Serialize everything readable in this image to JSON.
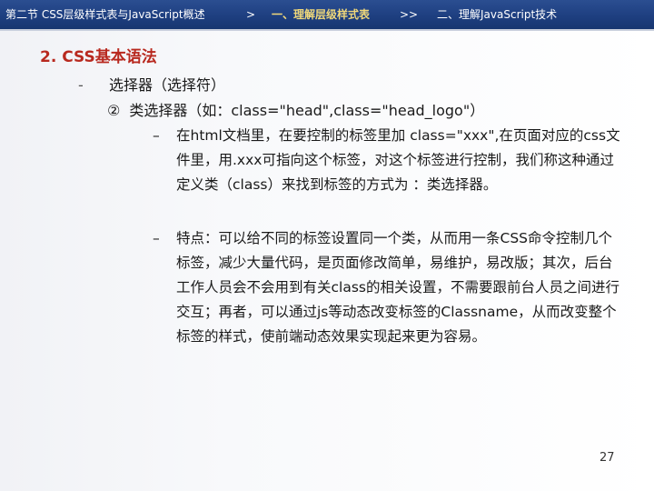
{
  "header": {
    "crumb1": "第二节 CSS层级样式表与JavaScript概述",
    "sep1": ">",
    "crumb2": "一、理解层级样式表",
    "sep2": ">>",
    "crumb3": "二、理解JavaScript技术"
  },
  "slide": {
    "heading": "2. CSS基本语法",
    "level1": {
      "marker": "-",
      "text": "选择器（选择符）"
    },
    "level2": {
      "marker": "②",
      "text": "类选择器（如：class=\"head\",class=\"head_logo\"）"
    },
    "bullets": [
      {
        "marker": "–",
        "text": "在html文档里，在要控制的标签里加 class=\"xxx\",在页面对应的css文件里，用.xxx可指向这个标签，对这个标签进行控制，我们称这种通过定义类（class）来找到标签的方式为 ：类选择器。"
      },
      {
        "marker": "–",
        "text": "特点：可以给不同的标签设置同一个类，从而用一条CSS命令控制几个标签，减少大量代码，是页面修改简单，易维护，易改版；其次，后台工作人员会不会用到有关class的相关设置，不需要跟前台人员之间进行交互；再者，可以通过js等动态改变标签的Classname，从而改变整个标签的样式，使前端动态效果实现起来更为容易。"
      }
    ],
    "page_number": "27"
  },
  "colors": {
    "header_bg": "#1e3f80",
    "heading": "#b8291f",
    "highlight": "#f0d87a"
  }
}
